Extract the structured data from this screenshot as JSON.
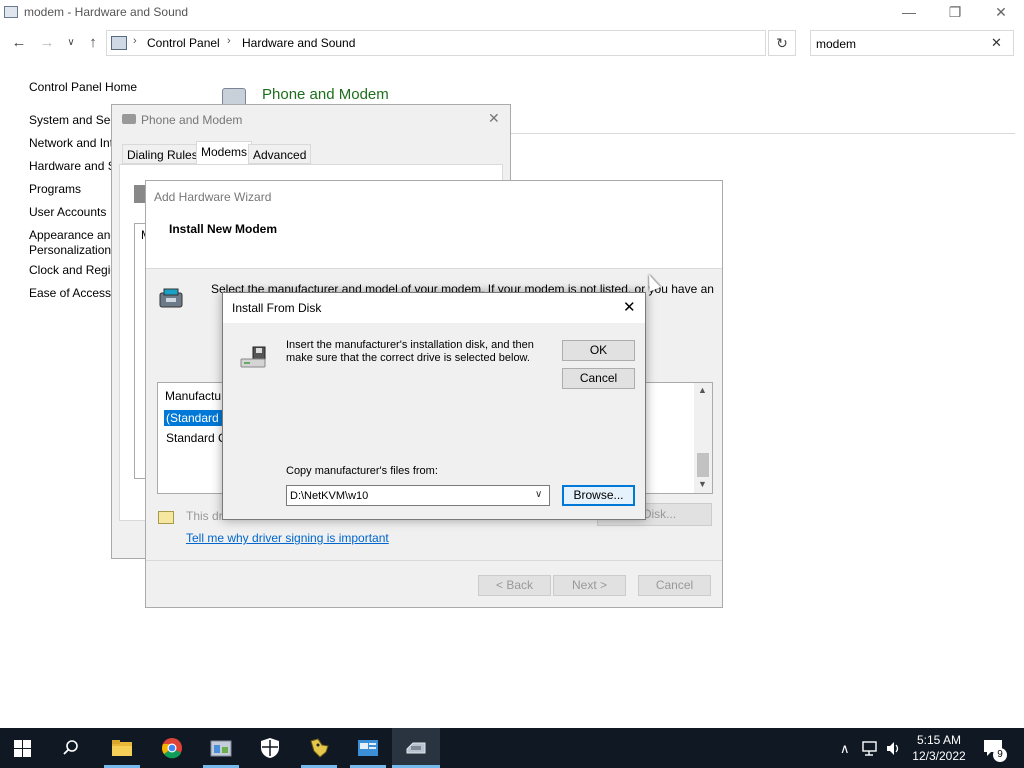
{
  "explorer": {
    "window_title": "modem - Hardware and Sound",
    "breadcrumbs": [
      "Control Panel",
      "Hardware and Sound"
    ],
    "search_value": "modem",
    "left_nav": {
      "home": "Control Panel Home",
      "items": [
        "System and Sec",
        "Network and Int",
        "Hardware and S",
        "Programs",
        "User Accounts",
        "Appearance and",
        "Personalization",
        "Clock and Regio",
        "Ease of Access"
      ]
    },
    "main_heading": "Phone and Modem"
  },
  "phone_modem": {
    "title": "Phone and Modem",
    "tabs": [
      "Dialing Rules",
      "Modems",
      "Advanced"
    ],
    "active_tab": "Modems",
    "list_fragment": "M"
  },
  "wizard": {
    "title": "Add Hardware Wizard",
    "heading": "Install New Modem",
    "instructions": "Select the manufacturer and model of your modem. If your modem is not listed, or you have an",
    "list_header": "Manufactu",
    "list_items": [
      "(Standard M",
      "Standard C"
    ],
    "selected_index": 0,
    "signing_text": "This dri",
    "signing_link": "Tell me why driver signing is important",
    "have_disk": "e Disk...",
    "back": "< Back",
    "next": "Next >",
    "cancel": "Cancel"
  },
  "install_from_disk": {
    "title": "Install From Disk",
    "instructions": "Insert the manufacturer's installation disk, and then make sure that the correct drive is selected below.",
    "ok": "OK",
    "cancel": "Cancel",
    "copy_label": "Copy manufacturer's files from:",
    "path_value": "D:\\NetKVM\\w10",
    "browse": "Browse..."
  },
  "taskbar": {
    "apps": [
      "file-explorer-icon",
      "chrome-icon",
      "control-panel-icon",
      "defender-icon",
      "dragon-icon",
      "system-info-icon",
      "phone-modem-icon"
    ],
    "time": "5:15 AM",
    "date": "12/3/2022",
    "notification_count": "9"
  },
  "colors": {
    "selection": "#0078d7",
    "heading_green": "#1e6e1e",
    "link": "#0066cc",
    "taskbar": "#101923"
  }
}
